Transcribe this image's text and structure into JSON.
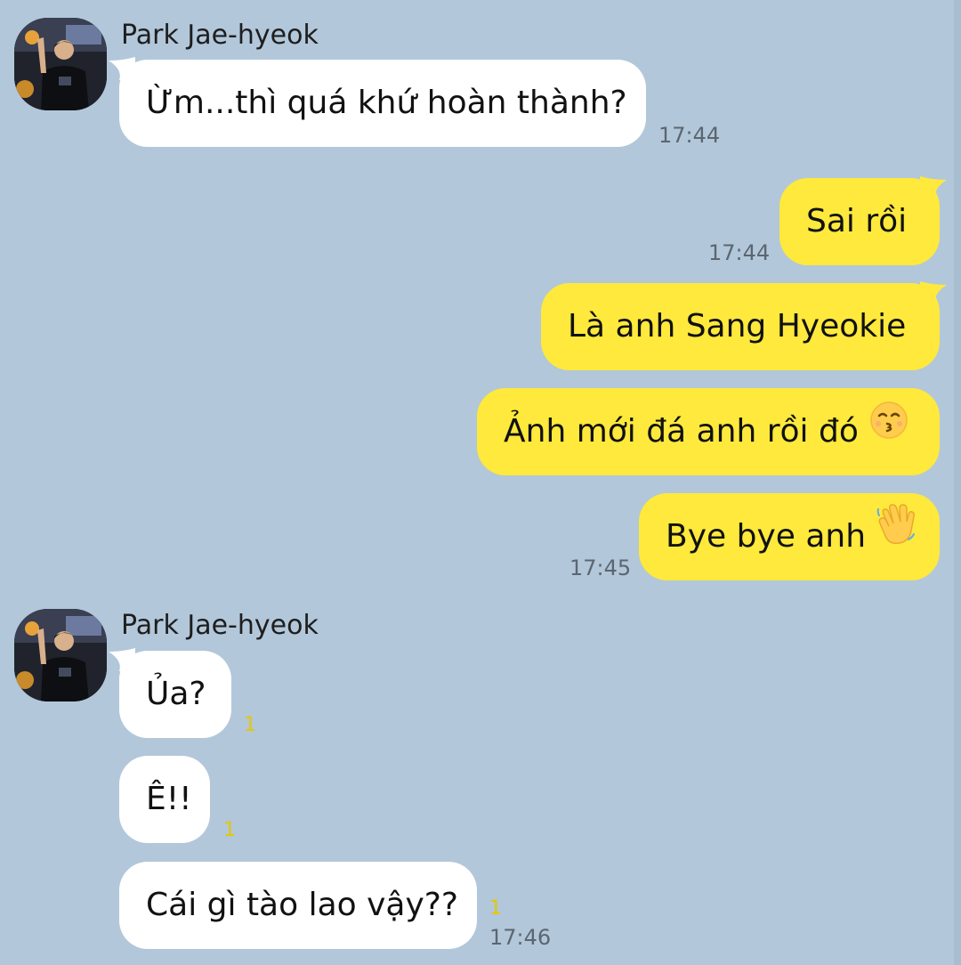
{
  "sender_name": "Park Jae-hyeok",
  "messages": [
    {
      "text": "Ừm...thì quá khứ hoàn thành?",
      "time": "17:44"
    },
    {
      "text": "Sai rồi",
      "time": "17:44"
    },
    {
      "text": "Là anh Sang Hyeokie"
    },
    {
      "text": "Ảnh mới đá anh rồi đó",
      "emoji": "kissing-face-icon"
    },
    {
      "text": "Bye bye anh",
      "emoji": "waving-hand-icon",
      "time": "17:45"
    },
    {
      "text": "Ủa?",
      "unread": "1"
    },
    {
      "text": "Ê!!",
      "unread": "1"
    },
    {
      "text": "Cái gì tào lao vậy??",
      "unread": "1",
      "time": "17:46"
    }
  ],
  "colors": {
    "background": "#b2c7da",
    "incoming_bubble": "#ffffff",
    "outgoing_bubble": "#fee93c",
    "unread_count": "#e6c700",
    "timestamp": "#5c6670"
  }
}
